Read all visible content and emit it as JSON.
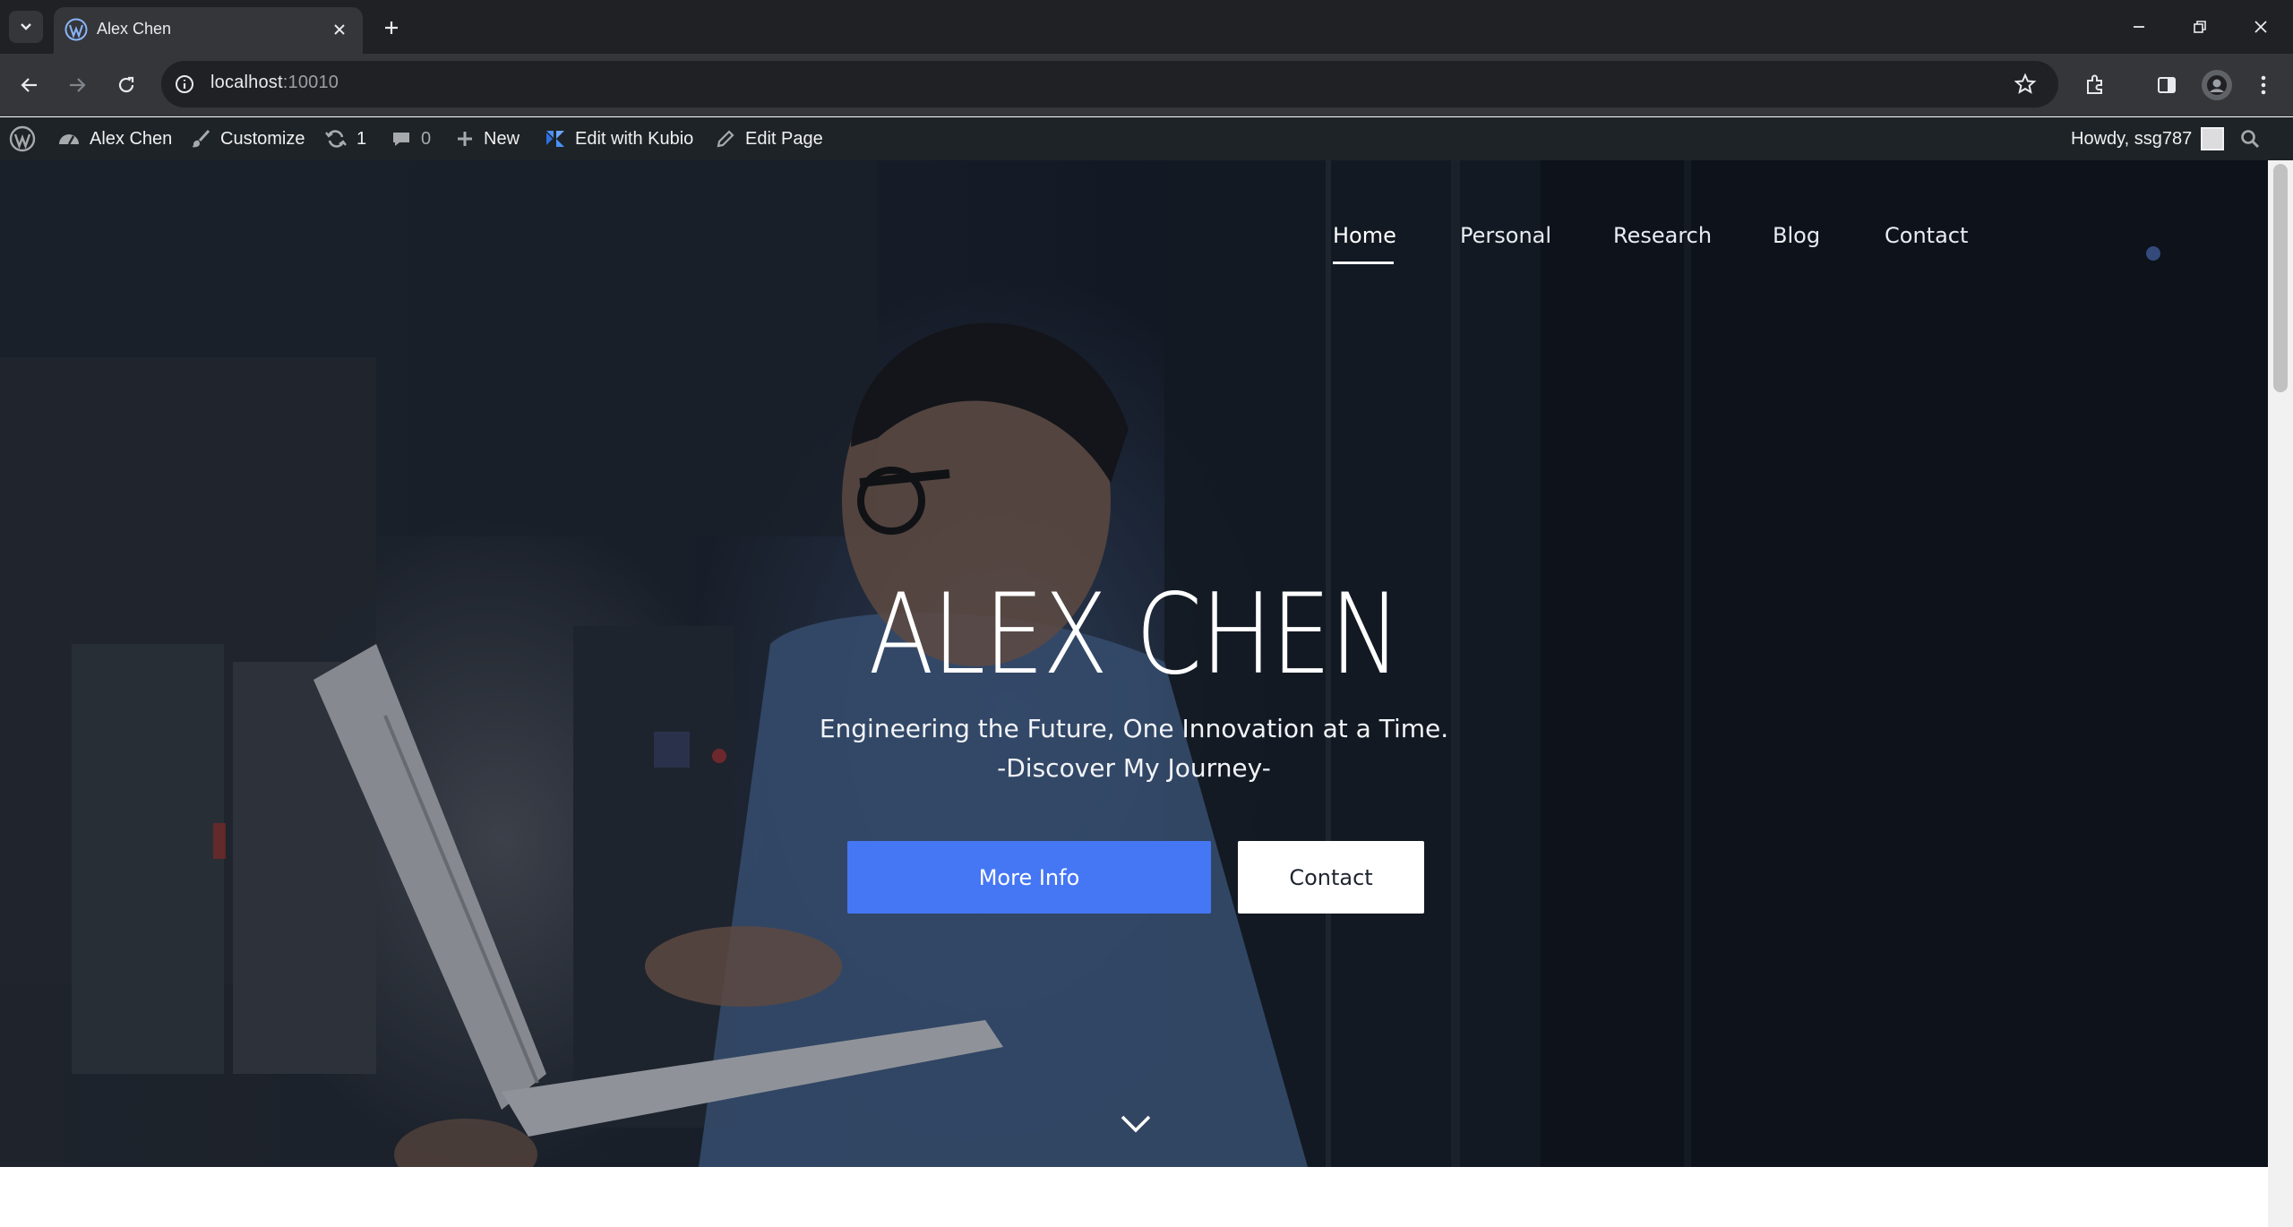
{
  "browser": {
    "tab_title": "Alex Chen",
    "url_host": "localhost",
    "url_port": ":10010"
  },
  "adminbar": {
    "site_name": "Alex Chen",
    "customize": "Customize",
    "updates_count": "1",
    "comments_count": "0",
    "new_label": "New",
    "kubio_label": "Edit with Kubio",
    "edit_page_label": "Edit Page",
    "howdy": "Howdy, ssg787"
  },
  "hero": {
    "menu": [
      {
        "label": "Home",
        "active": true
      },
      {
        "label": "Personal"
      },
      {
        "label": "Research"
      },
      {
        "label": "Blog"
      },
      {
        "label": "Contact"
      }
    ],
    "title": "ALEX CHEN",
    "subtitle_line1": "Engineering the Future, One Innovation at a Time.",
    "subtitle_line2": "-Discover My Journey-",
    "primary_button": "More Info",
    "secondary_button": "Contact"
  },
  "colors": {
    "accent": "#4577f5",
    "adminbar_bg": "#1d2327",
    "chrome_bg": "#35363a"
  }
}
